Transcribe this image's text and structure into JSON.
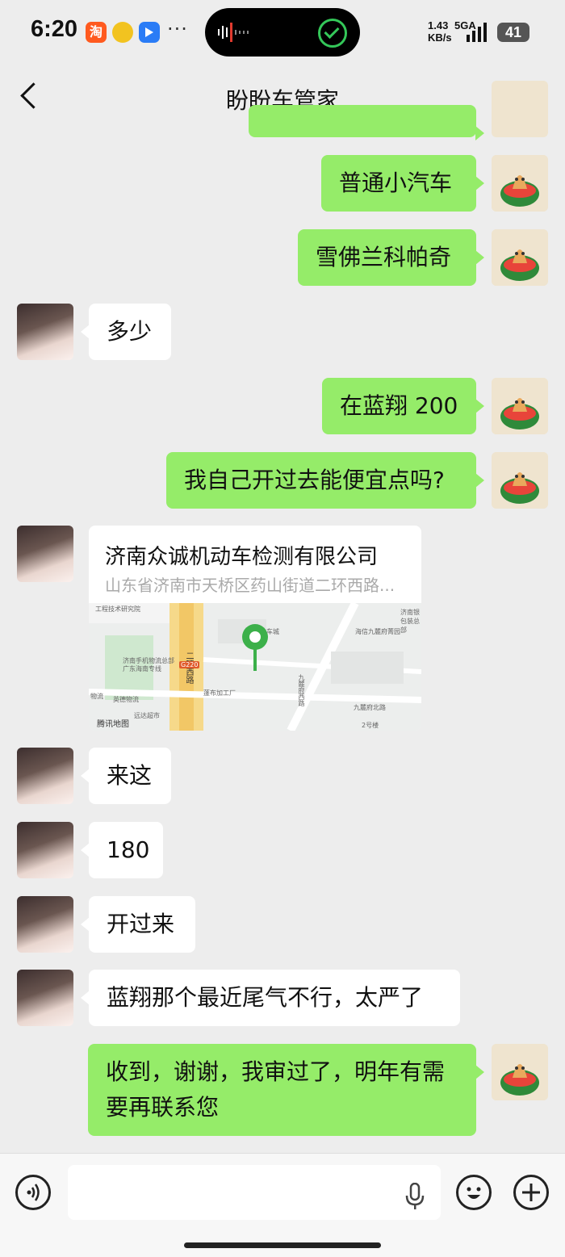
{
  "status": {
    "time": "6:20",
    "net_speed_value": "1.43",
    "net_speed_unit": "KB/s",
    "net_type": "5GA",
    "battery": "41",
    "taobao_icon_text": "淘"
  },
  "nav": {
    "title": "盼盼车管家"
  },
  "messages": [
    {
      "side": "out",
      "text": "普通小汽车"
    },
    {
      "side": "out",
      "text": "雪佛兰科帕奇"
    },
    {
      "side": "in",
      "text": "多少"
    },
    {
      "side": "out",
      "text": "在蓝翔 200"
    },
    {
      "side": "out",
      "text": "我自己开过去能便宜点吗?"
    },
    {
      "side": "in",
      "type": "location",
      "name": "济南众诚机动车检测有限公司",
      "address": "山东省济南市天桥区药山街道二环西路...",
      "map_credit": "腾讯地图"
    },
    {
      "side": "in",
      "text": "来这"
    },
    {
      "side": "in",
      "text": "180"
    },
    {
      "side": "in",
      "text": "开过来"
    },
    {
      "side": "in",
      "text": "蓝翔那个最近尾气不行，太严了"
    },
    {
      "side": "out",
      "text_line1": "收到，谢谢，我审过了，明年有需",
      "text_line2": "要再联系您"
    }
  ],
  "map_labels": [
    "二环西路",
    "海信九麓府菁园",
    "九麓府北路",
    "济南手机物流总部",
    "广东海南专线",
    "英德物流",
    "蓬布加工厂",
    "远达超市",
    "物流",
    "工程技术研究院",
    "九麓府西路",
    "济南银包装总部",
    "2号楼",
    "车城",
    "G220"
  ]
}
